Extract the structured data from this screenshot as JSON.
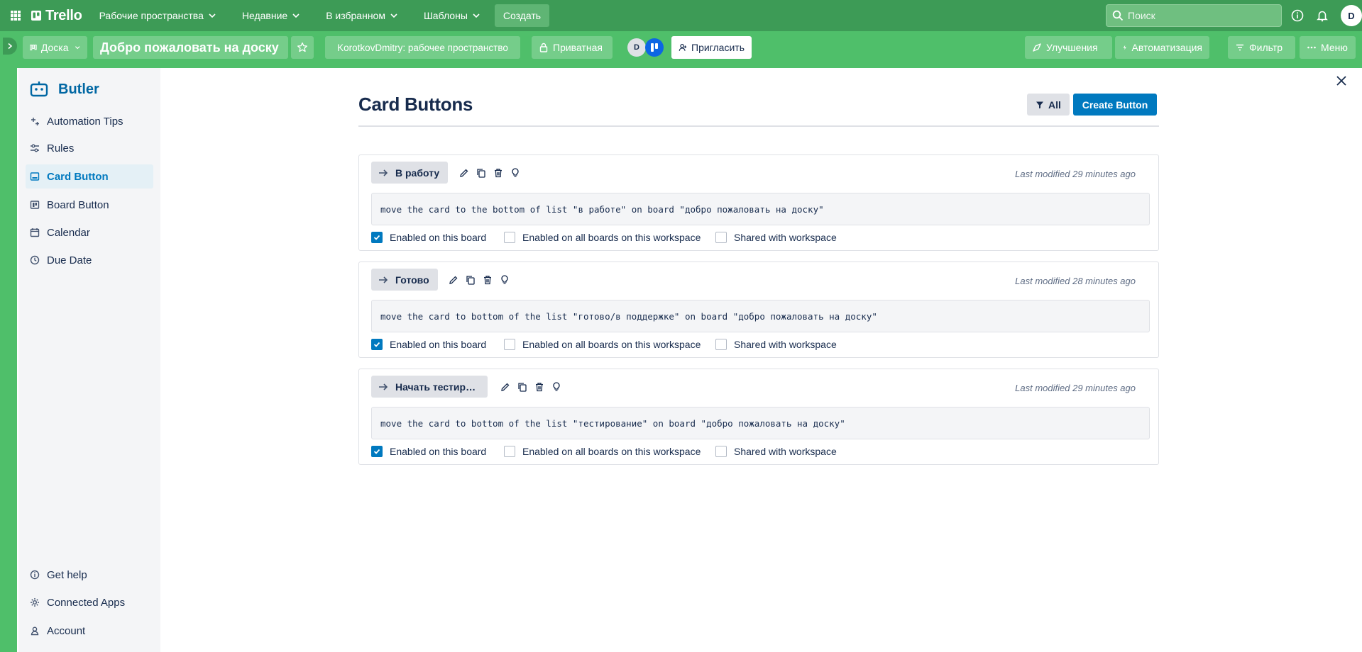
{
  "header": {
    "logo": "Trello",
    "nav": [
      "Рабочие пространства",
      "Недавние",
      "В избранном",
      "Шаблоны"
    ],
    "create": "Создать",
    "search_placeholder": "Поиск",
    "avatar_initial": "D"
  },
  "board": {
    "view": "Доска",
    "title": "Добро пожаловать на доску",
    "workspace": "KorotkovDmitry: рабочее пространство",
    "visibility": "Приватная",
    "member_initial": "D",
    "invite": "Пригласить",
    "improvements": "Улучшения",
    "automation": "Автоматизация",
    "filter": "Фильтр",
    "menu": "Меню"
  },
  "butler": {
    "brand": "Butler",
    "nav": [
      {
        "label": "Automation Tips",
        "icon": "sparkle-icon",
        "active": false
      },
      {
        "label": "Rules",
        "icon": "rules-icon",
        "active": false
      },
      {
        "label": "Card Button",
        "icon": "card-button-icon",
        "active": true
      },
      {
        "label": "Board Button",
        "icon": "board-button-icon",
        "active": false
      },
      {
        "label": "Calendar",
        "icon": "calendar-icon",
        "active": false
      },
      {
        "label": "Due Date",
        "icon": "clock-icon",
        "active": false
      }
    ],
    "footer": [
      {
        "label": "Get help",
        "icon": "info-icon"
      },
      {
        "label": "Connected Apps",
        "icon": "gear-icon"
      },
      {
        "label": "Account",
        "icon": "user-icon"
      }
    ]
  },
  "main": {
    "title": "Card Buttons",
    "filter_all": "All",
    "create_button": "Create Button",
    "buttons": [
      {
        "label": "В работу",
        "modified": "Last modified 29 minutes ago",
        "command": "move the card to the bottom of list \"в работе\" on board \"добро пожаловать на доску\"",
        "options": [
          {
            "label": "Enabled on this board",
            "checked": true
          },
          {
            "label": "Enabled on all boards on this workspace",
            "checked": false
          },
          {
            "label": "Shared with workspace",
            "checked": false
          }
        ]
      },
      {
        "label": "Готово",
        "modified": "Last modified 28 minutes ago",
        "command": "move the card to bottom of the list \"готово/в поддержке\" on board \"добро пожаловать на доску\"",
        "options": [
          {
            "label": "Enabled on this board",
            "checked": true
          },
          {
            "label": "Enabled on all boards on this workspace",
            "checked": false
          },
          {
            "label": "Shared with workspace",
            "checked": false
          }
        ]
      },
      {
        "label": "Начать тестирование",
        "modified": "Last modified 29 minutes ago",
        "command": "move the card to bottom of the list \"тестирование\" on board \"добро пожаловать на доску\"",
        "options": [
          {
            "label": "Enabled on this board",
            "checked": true
          },
          {
            "label": "Enabled on all boards on this workspace",
            "checked": false
          },
          {
            "label": "Shared with workspace",
            "checked": false
          }
        ]
      }
    ]
  },
  "colors": {
    "header_bg": "#3d9b56",
    "board_bg": "#4fbf6a",
    "accent": "#0079bf",
    "butler_brand": "#0067a3"
  }
}
